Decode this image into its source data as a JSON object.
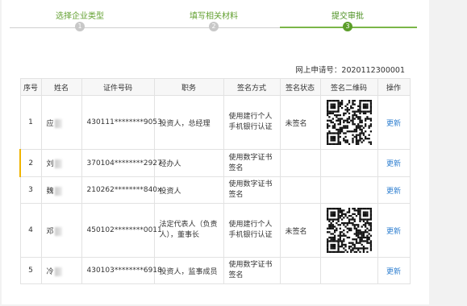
{
  "steps": [
    {
      "label": "选择企业类型",
      "num": "1"
    },
    {
      "label": "填写相关材料",
      "num": "2"
    },
    {
      "label": "提交审批",
      "num": "3",
      "active": true
    }
  ],
  "request_no_label": "网上申请号：2020112300001",
  "table": {
    "headers": [
      "序号",
      "姓名",
      "证件号码",
      "职务",
      "签名方式",
      "签名状态",
      "签名二维码",
      "操作"
    ],
    "rows": [
      {
        "no": "1",
        "name": "应",
        "id": "430111********9053",
        "role": "投资人，总经理",
        "method": "使用建行个人手机银行认证",
        "status": "未签名",
        "qr": true,
        "action": "更新"
      },
      {
        "no": "2",
        "name": "刘",
        "id": "370104********2927",
        "role": "经办人",
        "method": "使用数字证书签名",
        "status": "",
        "qr": false,
        "action": "更新"
      },
      {
        "no": "3",
        "name": "魏",
        "id": "210262********840x",
        "role": "投资人",
        "method": "使用数字证书签名",
        "status": "",
        "qr": false,
        "action": "更新"
      },
      {
        "no": "4",
        "name": "邓",
        "id": "450102********0011",
        "role": "法定代表人（负责人），董事长",
        "method": "使用建行个人手机银行认证",
        "status": "未签名",
        "qr": true,
        "action": "更新"
      },
      {
        "no": "5",
        "name": "冷",
        "id": "430103********6918",
        "role": "投资人，监事成员",
        "method": "使用数字证书签名",
        "status": "",
        "qr": false,
        "action": "更新"
      }
    ]
  }
}
